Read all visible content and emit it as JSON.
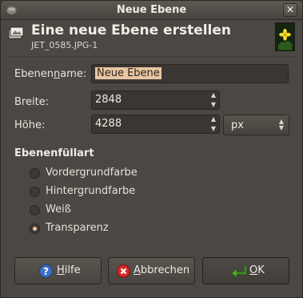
{
  "window": {
    "title": "Neue Ebene",
    "close_label": "✕"
  },
  "header": {
    "title": "Eine neue Ebene erstellen",
    "subtitle": "JET_0585.JPG-1"
  },
  "form": {
    "name_label_pre": "Ebenen",
    "name_label_mnemonic": "n",
    "name_label_post": "ame:",
    "name_value": "Neue Ebene",
    "width_label": "Breite:",
    "width_value": "2848",
    "height_label": "Höhe:",
    "height_value": "4288",
    "unit_value": "px"
  },
  "fill": {
    "title": "Ebenenfüllart",
    "options": [
      {
        "label": "Vordergrundfarbe",
        "selected": false
      },
      {
        "label": "Hintergrundfarbe",
        "selected": false
      },
      {
        "label": "Weiß",
        "selected": false
      },
      {
        "label": "Transparenz",
        "selected": true
      }
    ]
  },
  "buttons": {
    "help_mnemonic": "H",
    "help_rest": "ilfe",
    "cancel_mnemonic": "A",
    "cancel_rest": "bbrechen",
    "ok_mnemonic": "O",
    "ok_rest": "K"
  },
  "icons": {
    "help": "help-icon",
    "cancel": "cancel-icon",
    "ok": "ok-enter-icon",
    "header": "new-layer-icon",
    "title": "gimp-icon"
  },
  "colors": {
    "selection": "#e9c6a1",
    "radio_on": "#f0c89a",
    "help_blue": "#3b6fc4",
    "cancel_red": "#d52b2b",
    "ok_green": "#5ab52f"
  }
}
